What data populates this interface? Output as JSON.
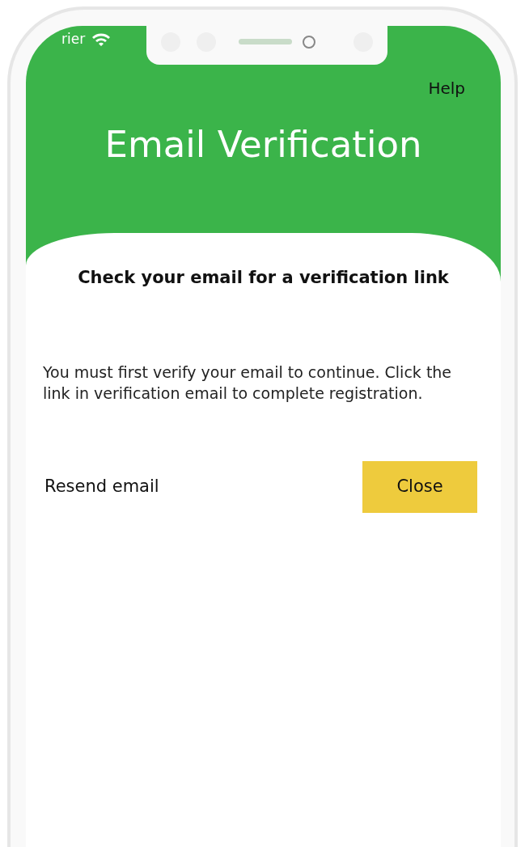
{
  "status_bar": {
    "carrier": "rier"
  },
  "header": {
    "help": "Help",
    "title": "Email Verification"
  },
  "card": {
    "heading": "Check your email for a verification link",
    "message": "You must first verify your email to continue. Click the link in verification email to complete registration."
  },
  "actions": {
    "resend": "Resend email",
    "close": "Close"
  }
}
